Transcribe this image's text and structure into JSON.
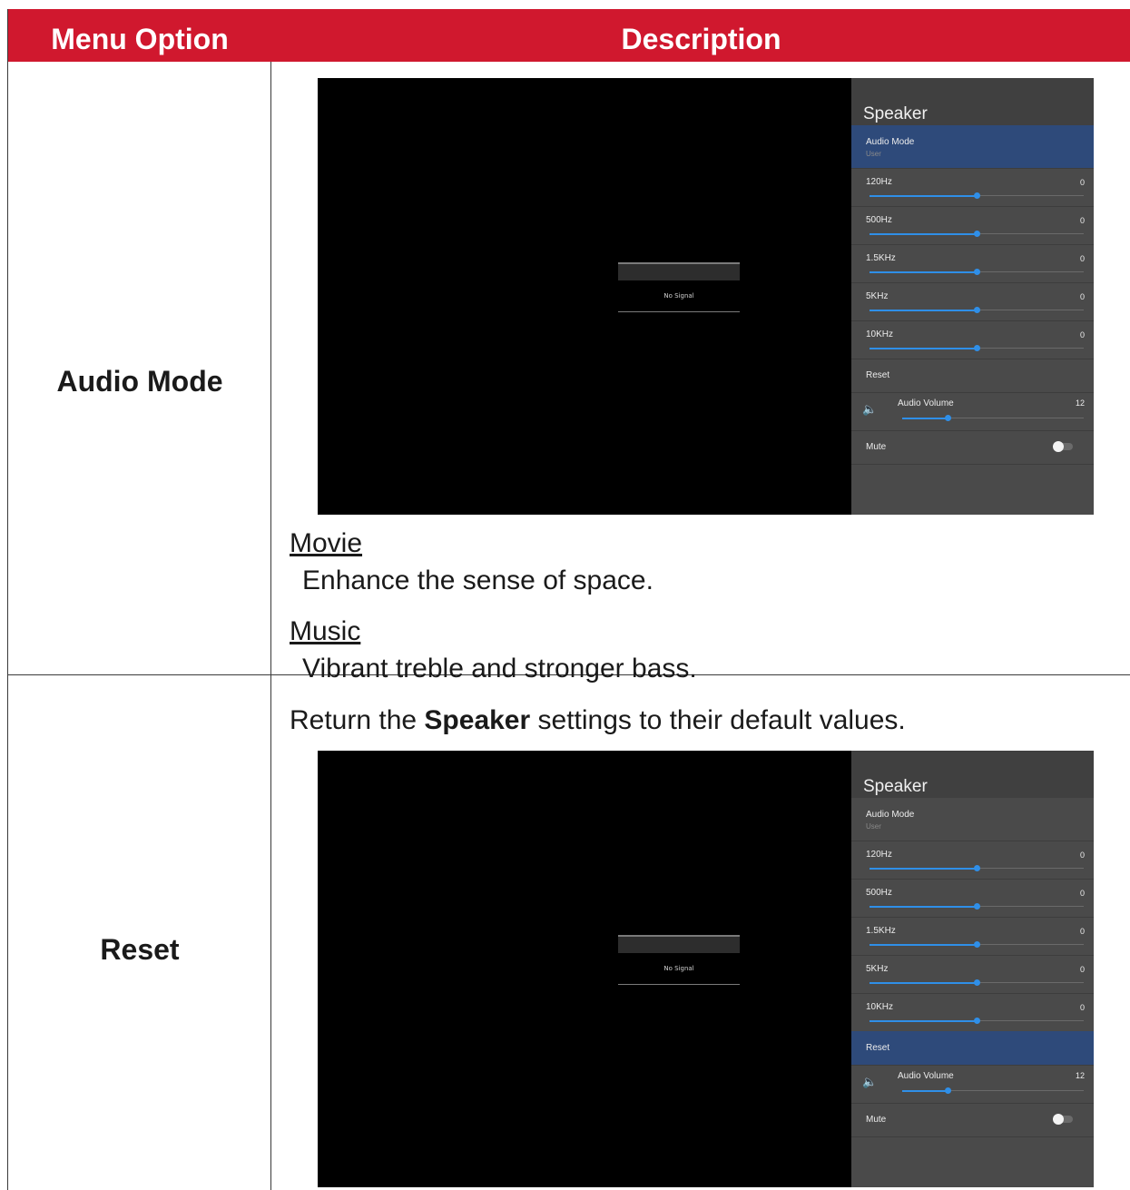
{
  "table": {
    "header": {
      "col1": "Menu Option",
      "col2": "Description"
    },
    "rows": [
      {
        "option": "Audio Mode",
        "items": [
          {
            "name": "Movie",
            "desc": "Enhance the sense of space."
          },
          {
            "name": "Music",
            "desc": "Vibrant treble and stronger bass."
          }
        ]
      },
      {
        "option": "Reset",
        "intro_pre": "Return the ",
        "intro_bold": "Speaker",
        "intro_post": " settings to their default values."
      }
    ]
  },
  "screens": [
    {
      "no_signal": "No Signal",
      "panel_title": "Speaker",
      "audio_mode": {
        "label": "Audio Mode",
        "value": "User"
      },
      "eq": [
        {
          "label": "120Hz",
          "value": "0",
          "level": 0.5
        },
        {
          "label": "500Hz",
          "value": "0",
          "level": 0.5
        },
        {
          "label": "1.5KHz",
          "value": "0",
          "level": 0.5
        },
        {
          "label": "5KHz",
          "value": "0",
          "level": 0.5
        },
        {
          "label": "10KHz",
          "value": "0",
          "level": 0.5
        }
      ],
      "reset": "Reset",
      "volume": {
        "label": "Audio Volume",
        "value": "12",
        "level": 0.25
      },
      "mute": {
        "label": "Mute",
        "on": false
      },
      "selected": "audio_mode"
    },
    {
      "no_signal": "No Signal",
      "panel_title": "Speaker",
      "audio_mode": {
        "label": "Audio Mode",
        "value": "User"
      },
      "eq": [
        {
          "label": "120Hz",
          "value": "0",
          "level": 0.5
        },
        {
          "label": "500Hz",
          "value": "0",
          "level": 0.5
        },
        {
          "label": "1.5KHz",
          "value": "0",
          "level": 0.5
        },
        {
          "label": "5KHz",
          "value": "0",
          "level": 0.5
        },
        {
          "label": "10KHz",
          "value": "0",
          "level": 0.5
        }
      ],
      "reset": "Reset",
      "volume": {
        "label": "Audio Volume",
        "value": "12",
        "level": 0.25
      },
      "mute": {
        "label": "Mute",
        "on": false
      },
      "selected": "reset"
    }
  ],
  "colors": {
    "header_bg": "#d0182e",
    "selected_row": "#2e4a7a",
    "slider_accent": "#2f8fe8"
  },
  "icons": {
    "volume": "speaker-volume-icon",
    "toggle": "mute-toggle"
  }
}
